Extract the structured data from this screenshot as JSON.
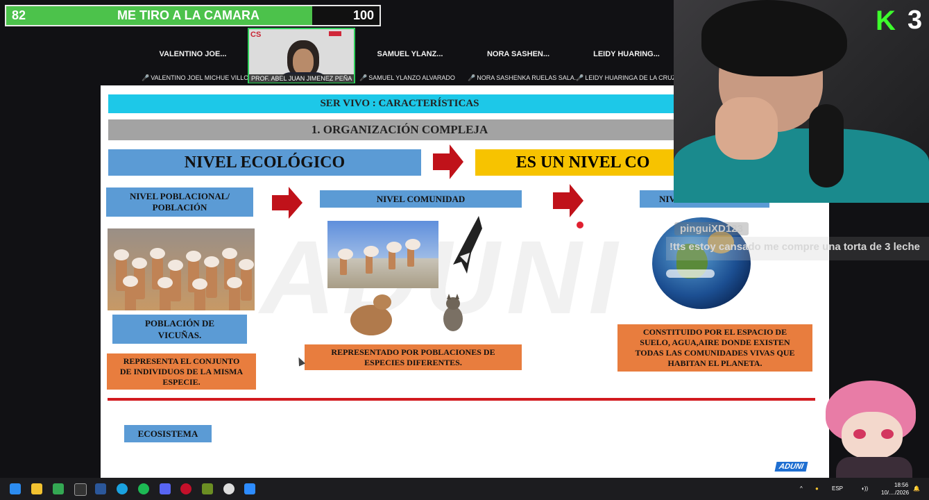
{
  "goal": {
    "current": "82",
    "title": "ME TIRO A LA CAMARA",
    "target": "100",
    "progress": 0.82
  },
  "participants": [
    {
      "short": "VALENTINO JOE...",
      "full": "VALENTINO JOEL MICHUE VILLO..."
    },
    {
      "full": "PROF. ABEL JUAN JIMENEZ PEÑA"
    },
    {
      "short": "SAMUEL YLANZ...",
      "full": "SAMUEL YLANZO ALVARADO"
    },
    {
      "short": "NORA SASHEN...",
      "full": "NORA SASHENKA RUELAS SALA..."
    },
    {
      "short": "LEIDY HUARING...",
      "full": "LEIDY HUARINGA DE LA CRUZ"
    }
  ],
  "slide": {
    "header1": "SER VIVO : CARACTERÍSTICAS",
    "header2": "1. ORGANIZACIÓN COMPLEJA",
    "nivel_ecologico": "NIVEL ECOLÓGICO",
    "es_un_nivel": "ES UN NIVEL CO",
    "nivel_poblacional": "NIVEL POBLACIONAL/\nPOBLACIÓN",
    "nivel_comunidad": "NIVEL COMUNIDAD",
    "nivel_partial": "NIV",
    "poblacion_vicunas": "POBLACIÓN DE\nVICUÑAS.",
    "representa": "REPRESENTA EL CONJUNTO\nDE INDIVIDUOS DE LA MISMA\nESPECIE.",
    "representado": "REPRESENTADO POR POBLACIONES DE\nESPECIES DIFERENTES.",
    "constituido": "CONSTITUIDO POR EL ESPACIO DE\nSUELO, AGUA,AIRE DONDE EXISTEN\nTODAS LAS COMUNIDADES VIVAS QUE\nHABITAN EL PLANETA.",
    "ecosistema": "ECOSISTEMA",
    "watermark": "ADUNI",
    "aduni_logo": "ADUNI"
  },
  "overlay": {
    "kick_logo": "K",
    "kick_number": "3",
    "chat_user": "pinguiXD123",
    "chat_message": "!tts estoy cansado me compre una torta de 3 leche"
  },
  "taskbar": {
    "language": "ESP",
    "time": "18:56",
    "date": "10/..../2026"
  },
  "colors": {
    "cyan": "#1dc8e8",
    "blue": "#5b9bd5",
    "orange": "#e87d3e",
    "yellow": "#f7c300",
    "red": "#c0121a",
    "goal_green": "#4cc24b"
  }
}
